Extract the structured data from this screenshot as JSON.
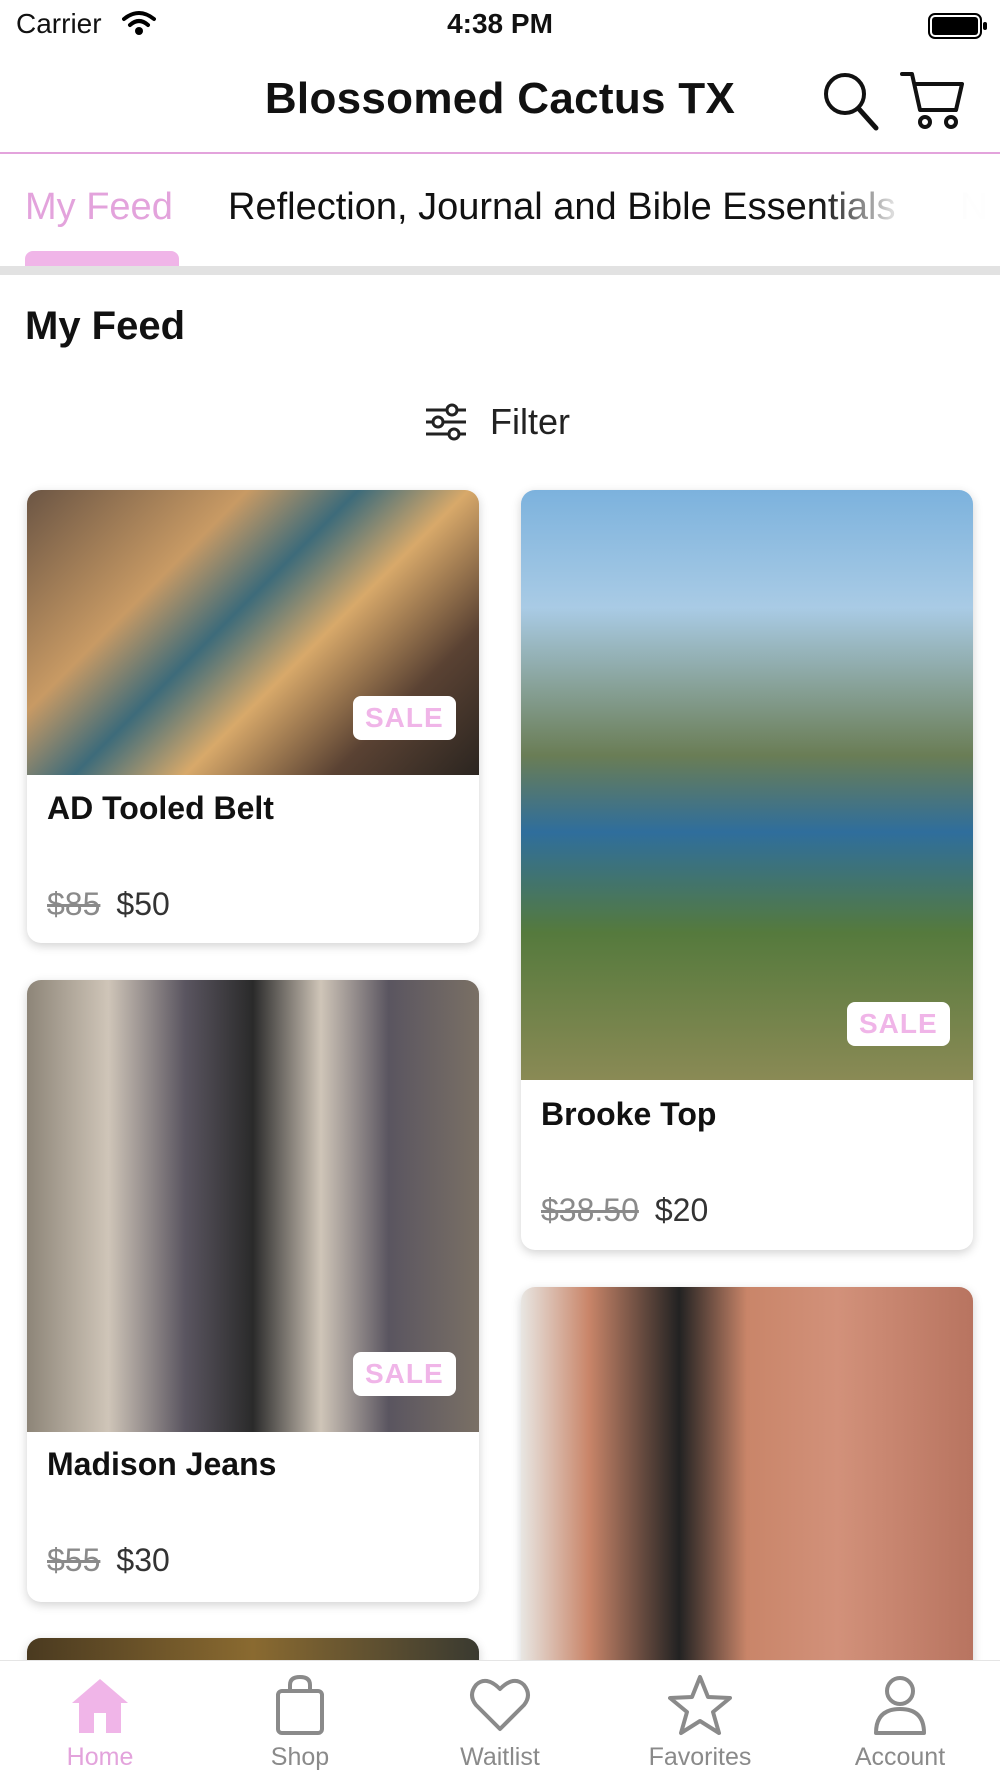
{
  "status_bar": {
    "carrier": "Carrier",
    "time": "4:38 PM"
  },
  "header": {
    "title": "Blossomed Cactus TX"
  },
  "tabs": [
    {
      "label": "My Feed",
      "active": true
    },
    {
      "label": "Reflection, Journal and Bible Essentials",
      "active": false
    },
    {
      "label": "N",
      "active": false
    }
  ],
  "section": {
    "title": "My Feed",
    "filter_label": "Filter"
  },
  "products": [
    {
      "title": "AD Tooled Belt",
      "badge": "SALE",
      "old_price": "$85",
      "price": "$50"
    },
    {
      "title": "Brooke Top",
      "badge": "SALE",
      "old_price": "$38.50",
      "price": "$20"
    },
    {
      "title": "Madison Jeans",
      "badge": "SALE",
      "old_price": "$55",
      "price": "$30"
    }
  ],
  "bottom_nav": [
    {
      "label": "Home",
      "icon": "home-icon",
      "active": true
    },
    {
      "label": "Shop",
      "icon": "shopping-bag-icon",
      "active": false
    },
    {
      "label": "Waitlist",
      "icon": "heart-icon",
      "active": false
    },
    {
      "label": "Favorites",
      "icon": "star-icon",
      "active": false
    },
    {
      "label": "Account",
      "icon": "person-icon",
      "active": false
    }
  ],
  "colors": {
    "accent": "#e3a3dc",
    "accent_light": "#f0b5e8",
    "text": "#111111",
    "muted": "#8a8a8a"
  }
}
